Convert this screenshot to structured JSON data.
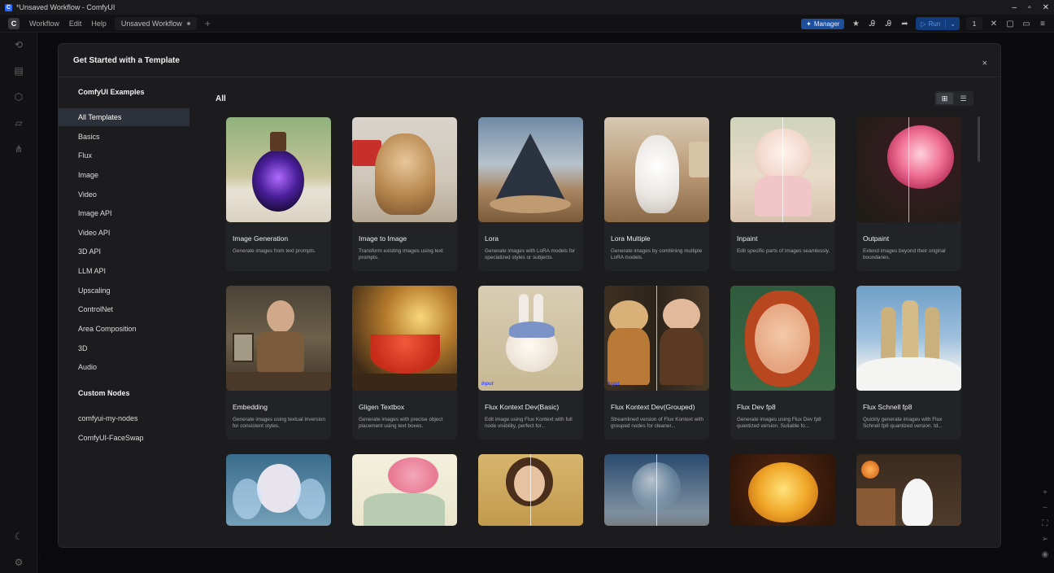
{
  "window": {
    "title": "*Unsaved Workflow - ComfyUI",
    "app_icon": "C",
    "controls": [
      "–",
      "▫",
      "✕"
    ]
  },
  "menubar": {
    "logo": "C",
    "items": [
      "Workflow",
      "Edit",
      "Help"
    ],
    "workflow_tab": "Unsaved Workflow",
    "manager_label": "Manager",
    "run_label": "Run",
    "run_count": "1"
  },
  "dialog": {
    "title": "Get Started with a Template",
    "close": "×",
    "content_title": "All"
  },
  "sidebar": {
    "section_examples": "ComfyUI Examples",
    "categories": [
      "All Templates",
      "Basics",
      "Flux",
      "Image",
      "Video",
      "Image API",
      "Video API",
      "3D API",
      "LLM API",
      "Upscaling",
      "ControlNet",
      "Area Composition",
      "3D",
      "Audio"
    ],
    "section_custom": "Custom Nodes",
    "custom": [
      "comfyui-my-nodes",
      "ComfyUI-FaceSwap"
    ]
  },
  "colors": {
    "accent": "#1d4f9c",
    "active_item": "#2d3139",
    "card_bg": "#222327"
  },
  "templates": [
    {
      "name": "Image Generation",
      "desc": "Generate images from text prompts."
    },
    {
      "name": "Image to Image",
      "desc": "Transform existing images using text prompts."
    },
    {
      "name": "Lora",
      "desc": "Generate images with LoRA models for specialized styles or subjects."
    },
    {
      "name": "Lora Multiple",
      "desc": "Generate images by combining multiple LoRA models."
    },
    {
      "name": "Inpaint",
      "desc": "Edit specific parts of images seamlessly."
    },
    {
      "name": "Outpaint",
      "desc": "Extend images beyond their original boundaries."
    },
    {
      "name": "Embedding",
      "desc": "Generate images using textual inversion for consistent styles."
    },
    {
      "name": "Gligen Textbox",
      "desc": "Generate images with precise object placement using text boxes."
    },
    {
      "name": "Flux Kontext Dev(Basic)",
      "desc": "Edit image using Flux Kontext with full node visibility, perfect for..."
    },
    {
      "name": "Flux Kontext Dev(Grouped)",
      "desc": "Streamlined version of Flux Kontext with grouped nodes for cleaner..."
    },
    {
      "name": "Flux Dev fp8",
      "desc": "Generate images using Flux Dev fp8 quantized version. Suitable fo..."
    },
    {
      "name": "Flux Schnell fp8",
      "desc": "Quickly generate images with Flux Schnell fp8 quantized version. Id..."
    }
  ],
  "thumb_labels": {
    "input": "Input"
  }
}
